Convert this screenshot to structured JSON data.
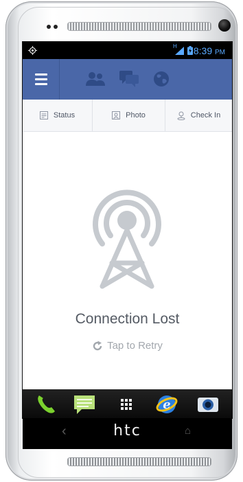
{
  "status_bar": {
    "time": "8:39",
    "ampm": "PM",
    "signal_badge": "H",
    "time_color": "#5aa9ff"
  },
  "header": {
    "bg_color": "#4a67a8",
    "icons": [
      "menu-icon",
      "friends-icon",
      "messages-icon",
      "globe-icon"
    ]
  },
  "actions": [
    {
      "label": "Status",
      "icon": "status-icon"
    },
    {
      "label": "Photo",
      "icon": "photo-icon"
    },
    {
      "label": "Check In",
      "icon": "checkin-icon"
    }
  ],
  "content": {
    "title": "Connection Lost",
    "retry_label": "Tap to Retry"
  },
  "dock": {
    "apps": [
      "phone-icon",
      "messages-app-icon",
      "apps-grid-icon",
      "browser-icon",
      "camera-icon"
    ]
  },
  "device": {
    "brand": "htc"
  }
}
